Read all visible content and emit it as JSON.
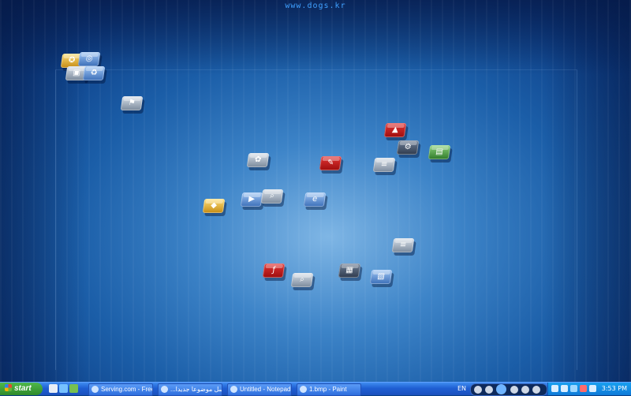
{
  "desktop": {
    "watermark": "www.dogs.kr"
  },
  "taskbar": {
    "start_label": "start",
    "tasks": [
      {
        "label": "Serving.com - Free i..."
      },
      {
        "label": "...ارسل موضوعا جديدا -"
      },
      {
        "label": "Untitled - Notepad"
      },
      {
        "label": "1.bmp - Paint"
      }
    ],
    "language": "EN",
    "clock": "3:53 PM"
  },
  "colors": {
    "taskbar": "#1f5fd3",
    "start_button": "#2f8a2a",
    "tray": "#0f7ad8"
  }
}
